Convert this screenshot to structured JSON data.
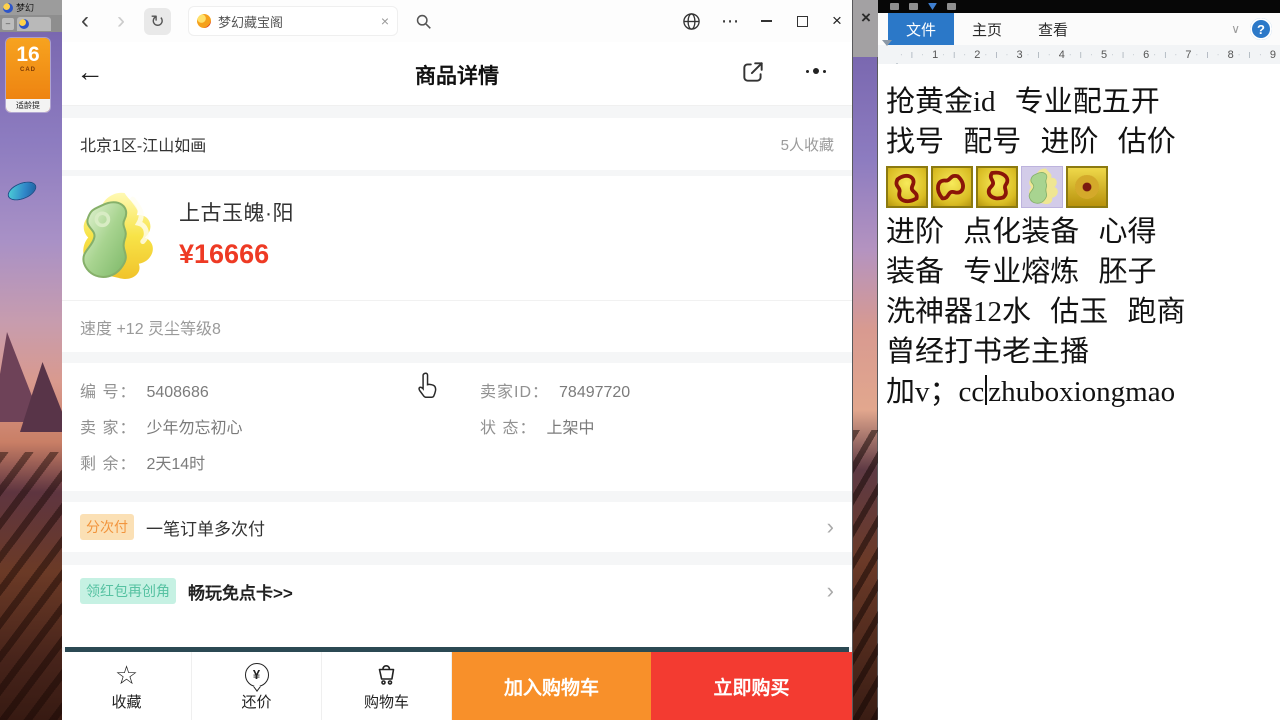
{
  "colors": {
    "price_red": "#ee3a24",
    "add_cart_orange": "#f8902a",
    "buy_now_red": "#f33b31",
    "installment_badge": "#f2953d",
    "promo_badge": "#57c2a2",
    "word_accent_blue": "#2b78c8",
    "divider_teal": "#2b4953"
  },
  "icons": {
    "back_nav": "‹",
    "forward_nav": "›",
    "refresh": "↻",
    "tab_close": "×",
    "more_menu": "⋯",
    "window_close": "×",
    "strip_close": "×",
    "page_back": "←",
    "chevron": "›",
    "star": "☆",
    "yen": "¥",
    "ribbon_collapse": "∨",
    "help": "?"
  },
  "game": {
    "window_title": "梦幻",
    "age_badge": "16",
    "age_org": "CAD",
    "age_label": "适龄提"
  },
  "browser": {
    "tab_title": "梦幻藏宝阁",
    "page": {
      "title": "商品详情",
      "server_row": {
        "server": "北京1区-江山如画",
        "favorites": "5人收藏"
      },
      "product": {
        "name": "上古玉魄·阳",
        "price": "¥16666",
        "attributes": "速度 +12 灵尘等级8"
      },
      "details": {
        "left": [
          {
            "label": "编 号：",
            "value": "5408686"
          },
          {
            "label": "卖 家：",
            "value": "少年勿忘初心"
          },
          {
            "label": "剩 余：",
            "value": "2天14时"
          }
        ],
        "right": [
          {
            "label": "卖家ID：",
            "value": "78497720"
          },
          {
            "label": "状 态：",
            "value": "上架中"
          }
        ]
      },
      "installment_row": {
        "badge": "分次付",
        "text": "一笔订单多次付"
      },
      "promo_row": {
        "badge": "领红包再创角",
        "text": "畅玩免点卡>>"
      },
      "bottom_nav": {
        "items": [
          {
            "label": "收藏"
          },
          {
            "label": "还价"
          },
          {
            "label": "购物车"
          }
        ],
        "add_cart": "加入购物车",
        "buy_now": "立即购买"
      }
    }
  },
  "word": {
    "menu_tabs": [
      "文件",
      "主页",
      "查看"
    ],
    "ruler": [
      "1",
      "2",
      "3",
      "4",
      "5",
      "6",
      "7",
      "8",
      "9"
    ],
    "doc": {
      "lines": [
        "抢黄金id 专业配五开",
        "找号 配号 进阶 估价",
        "进阶 点化装备 心得",
        "装备 专业熔炼 胚子",
        "洗神器12水 估玉 跑商",
        "曾经打书老主播"
      ],
      "last_line": {
        "before_caret": "加v；cc",
        "after_caret": "zhuboxiongmao"
      }
    }
  }
}
